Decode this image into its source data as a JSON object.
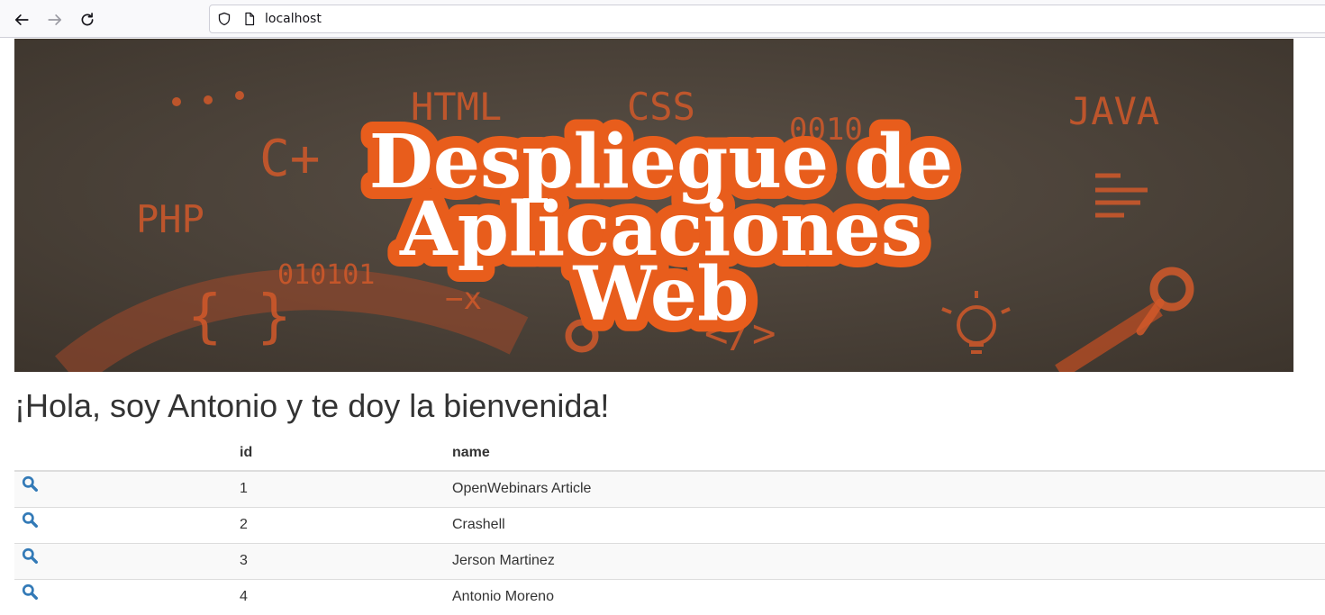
{
  "browser": {
    "url": "localhost"
  },
  "banner": {
    "title_line1": "Despliegue de",
    "title_line2": "Aplicaciones",
    "title_line3": "Web",
    "doodles": {
      "html": "HTML",
      "css": "CSS",
      "java": "JAVA",
      "php": "PHP",
      "cplus": "C+",
      "binary": "010101",
      "binary2": "0010",
      "tag": "</>",
      "braces": "{ }",
      "minus_x": "−x"
    }
  },
  "greeting": "¡Hola, soy Antonio y te doy la bienvenida!",
  "table": {
    "headers": [
      "",
      "id",
      "name"
    ],
    "rows": [
      {
        "id": "1",
        "name": "OpenWebinars Article"
      },
      {
        "id": "2",
        "name": "Crashell"
      },
      {
        "id": "3",
        "name": "Jerson Martinez"
      },
      {
        "id": "4",
        "name": "Antonio Moreno"
      }
    ]
  },
  "colors": {
    "link_icon": "#337ab7",
    "banner_orange": "#e85d1c",
    "banner_bg": "#4a4138"
  }
}
